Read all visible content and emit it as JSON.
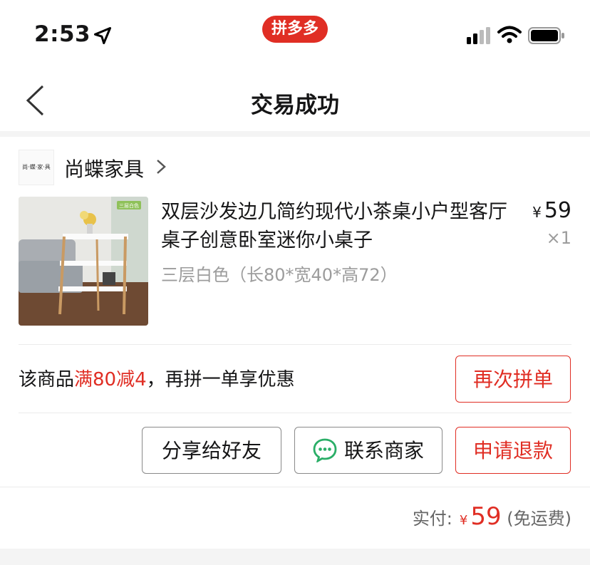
{
  "status_bar": {
    "time": "2:53",
    "app_badge": "拼多多"
  },
  "nav": {
    "title": "交易成功"
  },
  "shop": {
    "name": "尚蝶家具",
    "logo_text": "尚·蝶·家·具"
  },
  "product": {
    "title": "双层沙发边几简约现代小茶桌小户型客厅桌子创意卧室迷你小桌子",
    "spec": "三层白色（长80*宽40*高72）",
    "currency": "¥",
    "price": "59",
    "quantity": "×1",
    "image_tag": "三层白色"
  },
  "promo": {
    "prefix": "该商品",
    "highlight": "满80减4",
    "suffix": "，再拼一单享优惠"
  },
  "buttons": {
    "reorder": "再次拼单",
    "share": "分享给好友",
    "contact": "联系商家",
    "refund": "申请退款"
  },
  "total": {
    "label": "实付:",
    "currency": "¥",
    "amount": "59",
    "note": "(免运费)"
  },
  "colors": {
    "accent": "#e02e24",
    "text": "#151516",
    "muted": "#9c9c9c"
  }
}
